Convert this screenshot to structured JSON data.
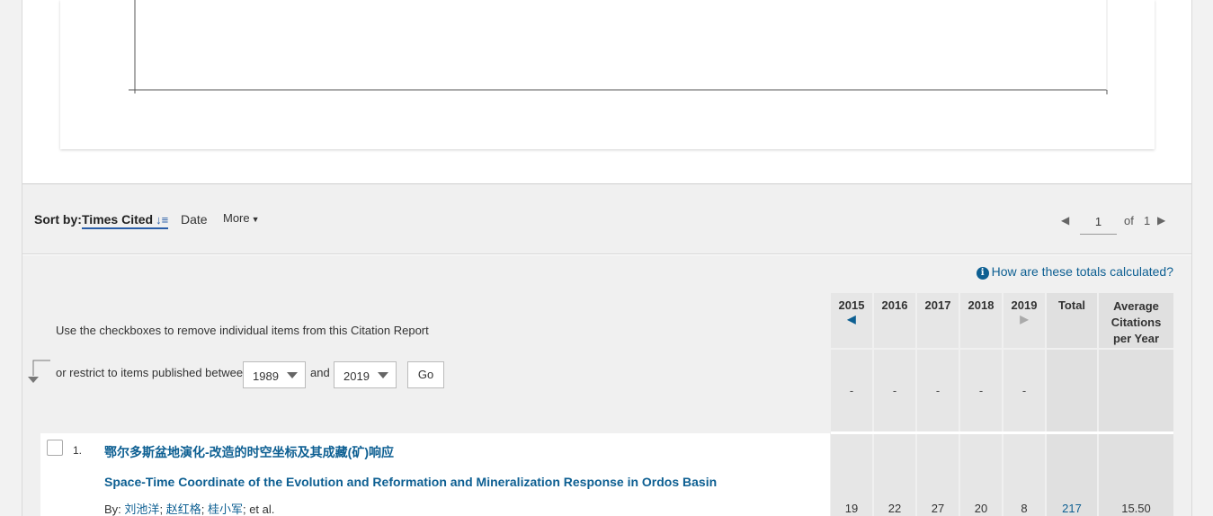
{
  "sort": {
    "label": "Sort by:",
    "active": "Times Cited",
    "active_icon": "sort-descending-icon",
    "date": "Date",
    "more": "More"
  },
  "pager": {
    "page": "1",
    "of": "of",
    "total": "1"
  },
  "report": {
    "how_calc": "How are these totals calculated?",
    "instruction": "Use the checkboxes to remove individual items from this Citation Report",
    "restrict_label": "or restrict to items published between",
    "from_year": "1989",
    "and_label": "and",
    "to_year": "2019",
    "go_label": "Go",
    "columns": {
      "y2015": "2015",
      "y2016": "2016",
      "y2017": "2017",
      "y2018": "2018",
      "y2019": "2019",
      "total": "Total",
      "avg_line1": "Average",
      "avg_line2": "Citations",
      "avg_line3": "per Year"
    },
    "summary_dashes": [
      "-",
      "-",
      "-",
      "-",
      "-"
    ]
  },
  "records": [
    {
      "num": "1.",
      "title_cn": "鄂尔多斯盆地演化-改造的时空坐标及其成藏(矿)响应",
      "title_en": "Space-Time Coordinate of the Evolution and Reformation and Mineralization Response in Ordos Basin",
      "by_label": "By:",
      "author1": "刘池洋",
      "sep1": ";",
      "author2": "赵红格",
      "sep2": ";",
      "author3": "桂小军",
      "etal": "; et al.",
      "y2015": "19",
      "y2016": "22",
      "y2017": "27",
      "y2018": "20",
      "y2019": "8",
      "total": "217",
      "average": "15.50"
    }
  ],
  "colors": {
    "link": "#0d5f92",
    "accent": "#2a5ea8"
  }
}
